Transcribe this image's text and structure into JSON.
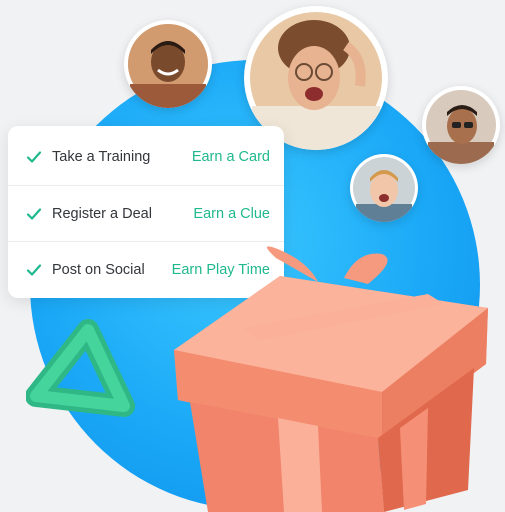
{
  "checklist": {
    "items": [
      {
        "task": "Take a Training",
        "reward": "Earn a Card"
      },
      {
        "task": "Register a Deal",
        "reward": "Earn a Clue"
      },
      {
        "task": "Post on Social",
        "reward": "Earn Play Time"
      }
    ]
  },
  "icons": [
    "check-icon",
    "gift-box-icon",
    "triangle-shape-icon"
  ],
  "colors": {
    "accent_green": "#20b98d",
    "blue_circle": "#1aa8f7",
    "gift_orange": "#f4876a",
    "triangle_green": "#35c48f",
    "text_dark": "#33363b"
  }
}
